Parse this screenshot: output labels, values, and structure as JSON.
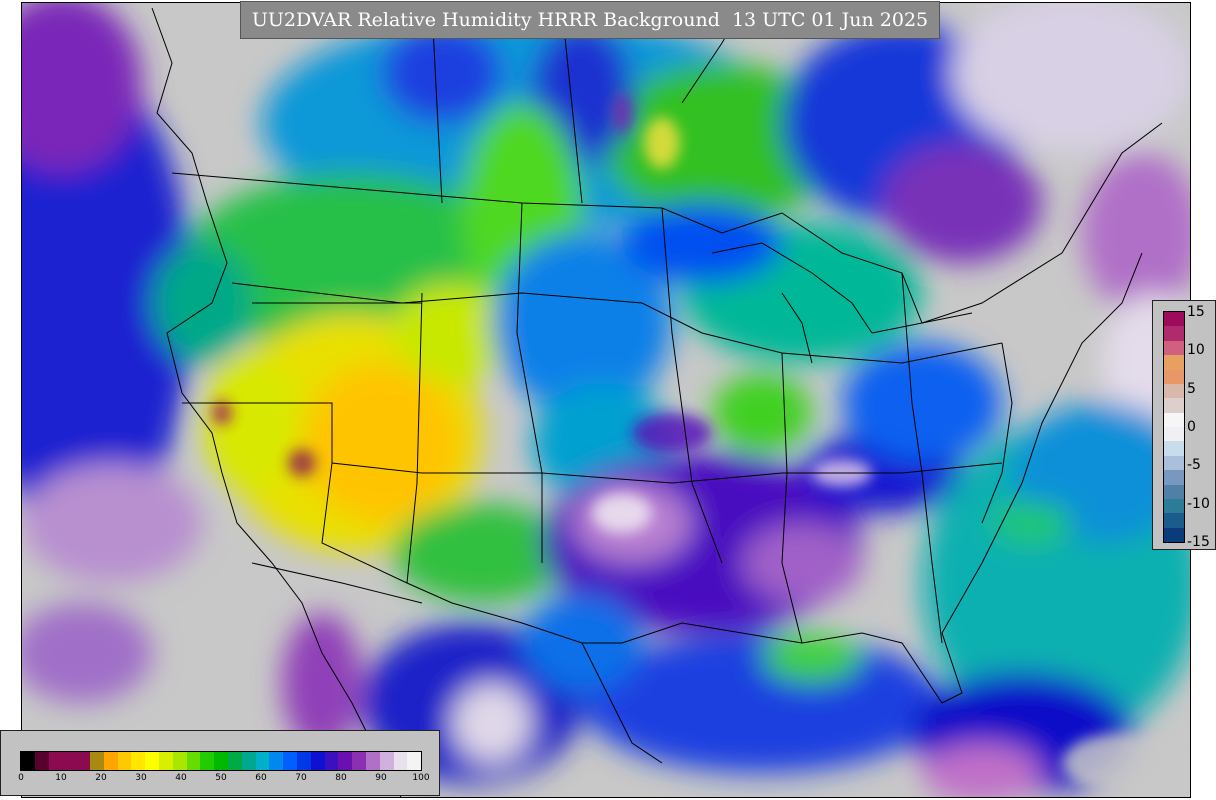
{
  "title": "UU2DVAR Relative Humidity HRRR Background  13 UTC 01 Jun 2025",
  "rh_colorbar": {
    "min": 0,
    "max": 100,
    "ticks": [
      "0",
      "10",
      "20",
      "30",
      "40",
      "50",
      "60",
      "70",
      "80",
      "90",
      "100"
    ],
    "colors": [
      "#000000",
      "#5a0030",
      "#8b0a50",
      "#8b0a50",
      "#8b0a50",
      "#a88a10",
      "#ffa500",
      "#ffc800",
      "#ffe800",
      "#ffff00",
      "#d8f000",
      "#a8e800",
      "#66dd00",
      "#22cc00",
      "#00b800",
      "#00aa44",
      "#00a890",
      "#00b0c8",
      "#0088ee",
      "#0060ff",
      "#0038e8",
      "#1010d0",
      "#3a10c0",
      "#6a10b0",
      "#8a30b0",
      "#b070c8",
      "#d0b0dc",
      "#e8e0ec",
      "#f4f4f4"
    ]
  },
  "diff_colorbar": {
    "ticks": [
      "15",
      "10",
      "5",
      "0",
      "-5",
      "-10",
      "-15"
    ],
    "colors": [
      "#9c0c5a",
      "#b02a6e",
      "#d06080",
      "#e8a060",
      "#e89868",
      "#d8b8a8",
      "#ddd0cc",
      "#f6f6f6",
      "#f0f0f4",
      "#c8dcec",
      "#a8c0dc",
      "#7898c0",
      "#5080a8",
      "#2c7c98",
      "#1a5c8c",
      "#0a3c7c"
    ]
  }
}
